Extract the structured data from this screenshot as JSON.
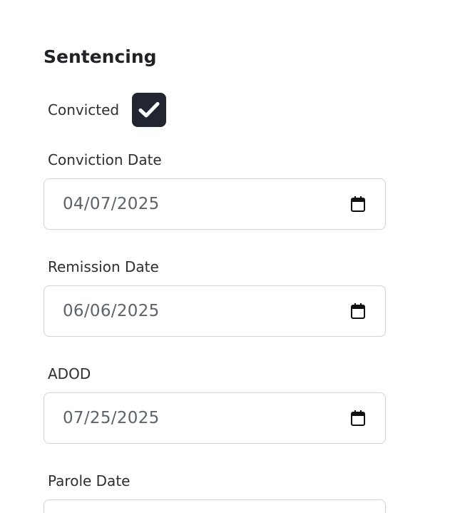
{
  "section": {
    "title": "Sentencing"
  },
  "convicted": {
    "label": "Convicted",
    "checked": true,
    "check_icon": "checkmark-icon",
    "box_color": "#212631"
  },
  "fields": [
    {
      "label": "Conviction Date",
      "value": "04/07/2025",
      "icon": "calendar-icon"
    },
    {
      "label": "Remission Date",
      "value": "06/06/2025",
      "icon": "calendar-icon"
    },
    {
      "label": "ADOD",
      "value": "07/25/2025",
      "icon": "calendar-icon"
    },
    {
      "label": "Parole Date",
      "value": "",
      "icon": "calendar-icon"
    }
  ]
}
